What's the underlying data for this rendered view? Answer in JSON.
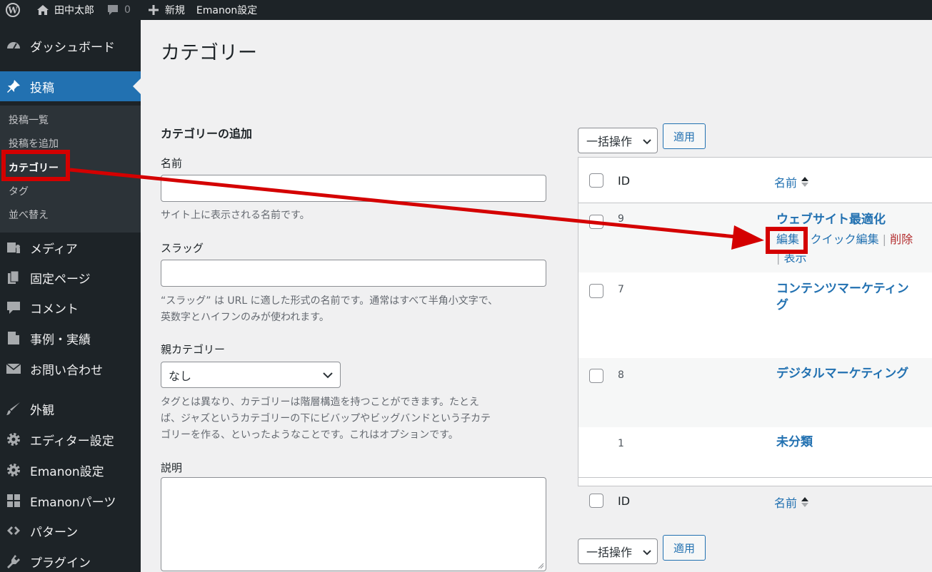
{
  "adminbar": {
    "site_name": "田中太郎",
    "comments_count": "0",
    "new_label": "新規",
    "theme_settings": "Emanon設定"
  },
  "sidebar": {
    "items": [
      {
        "label": "ダッシュボード",
        "icon": "dashboard-icon"
      },
      {
        "label": "投稿",
        "icon": "pin-icon"
      },
      {
        "label": "メディア",
        "icon": "media-icon"
      },
      {
        "label": "固定ページ",
        "icon": "page-icon"
      },
      {
        "label": "コメント",
        "icon": "comment-icon"
      },
      {
        "label": "事例・実績",
        "icon": "case-icon"
      },
      {
        "label": "お問い合わせ",
        "icon": "mail-icon"
      },
      {
        "label": "外観",
        "icon": "brush-icon"
      },
      {
        "label": "エディター設定",
        "icon": "gear-icon"
      },
      {
        "label": "Emanon設定",
        "icon": "gear-icon"
      },
      {
        "label": "Emanonパーツ",
        "icon": "grid-icon"
      },
      {
        "label": "パターン",
        "icon": "pattern-icon"
      },
      {
        "label": "プラグイン",
        "icon": "plugin-icon"
      }
    ],
    "submenu": [
      "投稿一覧",
      "投稿を追加",
      "カテゴリー",
      "タグ",
      "並べ替え"
    ]
  },
  "page": {
    "title": "カテゴリー"
  },
  "form": {
    "section_title": "カテゴリーの追加",
    "name_label": "名前",
    "name_help": "サイト上に表示される名前です。",
    "slug_label": "スラッグ",
    "slug_help_1": "“スラッグ” は URL に適した形式の名前です。通常はすべて半角小文字で、",
    "slug_help_2": "英数字とハイフンのみが使われます。",
    "parent_label": "親カテゴリー",
    "parent_value": "なし",
    "parent_help_1": "タグとは異なり、カテゴリーは階層構造を持つことができます。たとえ",
    "parent_help_2": "ば、ジャズというカテゴリーの下にビバップやビッグバンドという子カテ",
    "parent_help_3": "ゴリーを作る、といったようなことです。これはオプションです。",
    "desc_label": "説明"
  },
  "table": {
    "bulk_label": "一括操作",
    "apply_label": "適用",
    "col_id": "ID",
    "col_name": "名前",
    "rows": [
      {
        "id": "9",
        "name": "ウェブサイト最適化",
        "edit": "編集",
        "quick_edit": "クイック編集",
        "delete": "削除",
        "view": "表示"
      },
      {
        "id": "7",
        "name_1": "コンテンツマーケティン",
        "name_2": "グ"
      },
      {
        "id": "8",
        "name": "デジタルマーケティング"
      },
      {
        "id": "1",
        "name": "未分類"
      }
    ]
  },
  "colors": {
    "admin_dark": "#1d2327",
    "accent": "#2271b1",
    "highlight": "#d40000"
  }
}
